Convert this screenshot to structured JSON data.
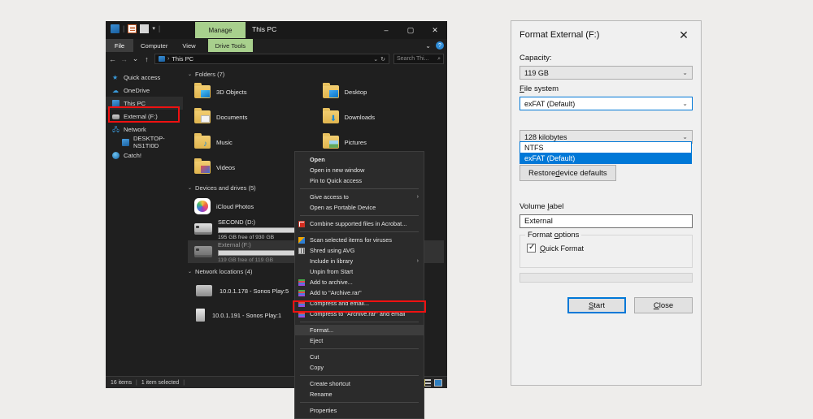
{
  "explorer": {
    "title": "This PC",
    "context_tab": "Manage",
    "quick_access_icons": [
      "pc-icon",
      "properties-icon",
      "new-folder-icon",
      "dropdown-caret-icon"
    ],
    "window_buttons": {
      "minimize": "–",
      "maximize": "▢",
      "close": "✕"
    },
    "tabs": [
      {
        "label": "File"
      },
      {
        "label": "Computer"
      },
      {
        "label": "View"
      },
      {
        "label": "Drive Tools"
      }
    ],
    "ribbon_expand": "⌄",
    "help": "?",
    "address": {
      "back": "←",
      "forward": "→",
      "recent": "⌄",
      "up": "↑",
      "crumb_sep": "›",
      "path": "This PC",
      "dropdown": "⌄",
      "refresh": "↻",
      "search_placeholder": "Search Thi...",
      "search_icon": "⌕"
    },
    "sidebar": [
      {
        "label": "Quick access",
        "icon": "star-icon",
        "indent": false,
        "selected": false
      },
      {
        "label": "OneDrive",
        "icon": "cloud-icon",
        "indent": false,
        "selected": false
      },
      {
        "label": "This PC",
        "icon": "pc-icon",
        "indent": false,
        "selected": true
      },
      {
        "label": "External (F:)",
        "icon": "usb-drive-icon",
        "indent": false,
        "selected": false
      },
      {
        "label": "Network",
        "icon": "network-icon",
        "indent": false,
        "selected": false
      },
      {
        "label": "DESKTOP-NS1TI0D",
        "icon": "pc-icon",
        "indent": true,
        "selected": false
      },
      {
        "label": "Catch!",
        "icon": "catch-app-icon",
        "indent": false,
        "selected": false
      }
    ],
    "groups": {
      "folders_header": "Folders (7)",
      "devices_header": "Devices and drives (5)",
      "network_header": "Network locations (4)"
    },
    "folders": [
      {
        "label": "3D Objects",
        "overlay": "ov-3d"
      },
      {
        "label": "Desktop",
        "overlay": "ov-desk"
      },
      {
        "label": "Documents",
        "overlay": "ov-doc"
      },
      {
        "label": "Downloads",
        "overlay": "ov-dl"
      },
      {
        "label": "Music",
        "overlay": "ov-music"
      },
      {
        "label": "Pictures",
        "overlay": "ov-pic"
      },
      {
        "label": "Videos",
        "overlay": "ov-vid"
      }
    ],
    "drives": [
      {
        "name": "iCloud Photos",
        "type": "app",
        "sub": "",
        "fill_pct": 0
      },
      {
        "name": "SECOND (D:)",
        "type": "disk",
        "sub": "195 GB free of 930 GB",
        "fill_pct": 79
      },
      {
        "name": "External (F:)",
        "type": "disk",
        "sub": "119 GB free of 119 GB",
        "fill_pct": 0,
        "selected": true
      }
    ],
    "network_locations": [
      {
        "label": "10.0.1.178 - Sonos Play:5",
        "icon": "speaker-wide-icon"
      },
      {
        "label": "10.0.1.191 - Sonos Play:1",
        "icon": "speaker-tall-icon"
      }
    ],
    "status": {
      "items_count": "16 items",
      "selection": "1 item selected",
      "trailing_sep": "|"
    }
  },
  "context_menu": {
    "items": [
      {
        "label": "Open",
        "bold": true,
        "icon": "",
        "submenu": "",
        "sep_after": false
      },
      {
        "label": "Open in new window",
        "bold": false,
        "icon": "",
        "submenu": "",
        "sep_after": false
      },
      {
        "label": "Pin to Quick access",
        "bold": false,
        "icon": "",
        "submenu": "",
        "sep_after": true
      },
      {
        "label": "Give access to",
        "bold": false,
        "icon": "",
        "submenu": "›",
        "sep_after": false
      },
      {
        "label": "Open as Portable Device",
        "bold": false,
        "icon": "",
        "submenu": "",
        "sep_after": true
      },
      {
        "label": "Combine supported files in Acrobat...",
        "bold": false,
        "icon": "acrobat",
        "submenu": "",
        "sep_after": true
      },
      {
        "label": "Scan selected items for viruses",
        "bold": false,
        "icon": "avg",
        "submenu": "",
        "sep_after": false
      },
      {
        "label": "Shred using AVG",
        "bold": false,
        "icon": "shred",
        "submenu": "",
        "sep_after": false
      },
      {
        "label": "Include in library",
        "bold": false,
        "icon": "",
        "submenu": "›",
        "sep_after": false
      },
      {
        "label": "Unpin from Start",
        "bold": false,
        "icon": "",
        "submenu": "",
        "sep_after": false
      },
      {
        "label": "Add to archive...",
        "bold": false,
        "icon": "rar",
        "submenu": "",
        "sep_after": false
      },
      {
        "label": "Add to \"Archive.rar\"",
        "bold": false,
        "icon": "rar",
        "submenu": "",
        "sep_after": false
      },
      {
        "label": "Compress and email...",
        "bold": false,
        "icon": "rar",
        "submenu": "",
        "sep_after": false
      },
      {
        "label": "Compress to \"Archive.rar\" and email",
        "bold": false,
        "icon": "rar",
        "submenu": "",
        "sep_after": true
      },
      {
        "label": "Format...",
        "bold": false,
        "icon": "",
        "submenu": "",
        "sep_after": false,
        "highlighted": true
      },
      {
        "label": "Eject",
        "bold": false,
        "icon": "",
        "submenu": "",
        "sep_after": true
      },
      {
        "label": "Cut",
        "bold": false,
        "icon": "",
        "submenu": "",
        "sep_after": false
      },
      {
        "label": "Copy",
        "bold": false,
        "icon": "",
        "submenu": "",
        "sep_after": true
      },
      {
        "label": "Create shortcut",
        "bold": false,
        "icon": "",
        "submenu": "",
        "sep_after": false
      },
      {
        "label": "Rename",
        "bold": false,
        "icon": "",
        "submenu": "",
        "sep_after": true
      },
      {
        "label": "Properties",
        "bold": false,
        "icon": "",
        "submenu": "",
        "sep_after": false
      }
    ]
  },
  "dialog": {
    "title": "Format External (F:)",
    "close_icon": "✕",
    "capacity_label": "Capacity:",
    "capacity_value": "119 GB",
    "filesystem_label": "File system",
    "filesystem_value": "exFAT (Default)",
    "filesystem_options": [
      {
        "label": "NTFS",
        "selected": false
      },
      {
        "label": "exFAT (Default)",
        "selected": true
      }
    ],
    "allocation_value": "128 kilobytes",
    "restore_defaults_label": "Restore device defaults",
    "volume_label_label": "Volume label",
    "volume_label_value": "External",
    "format_options_legend": "Format options",
    "quick_format_label": "Quick Format",
    "quick_format_checked": true,
    "start_label": "Start",
    "close_label": "Close",
    "chevron": "⌄",
    "accent_color": "#0078d7"
  }
}
